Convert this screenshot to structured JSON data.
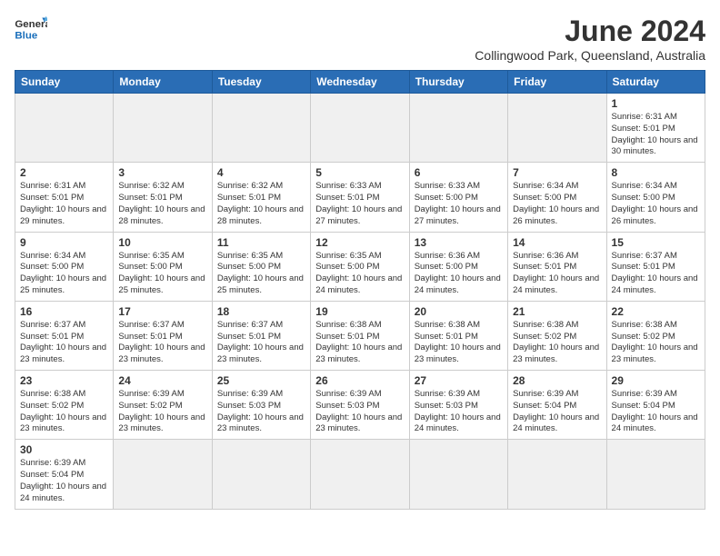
{
  "header": {
    "logo_general": "General",
    "logo_blue": "Blue",
    "title": "June 2024",
    "subtitle": "Collingwood Park, Queensland, Australia"
  },
  "days_of_week": [
    "Sunday",
    "Monday",
    "Tuesday",
    "Wednesday",
    "Thursday",
    "Friday",
    "Saturday"
  ],
  "weeks": [
    [
      {
        "day": "",
        "empty": true
      },
      {
        "day": "",
        "empty": true
      },
      {
        "day": "",
        "empty": true
      },
      {
        "day": "",
        "empty": true
      },
      {
        "day": "",
        "empty": true
      },
      {
        "day": "",
        "empty": true
      },
      {
        "day": "1",
        "sunrise": "6:31 AM",
        "sunset": "5:01 PM",
        "daylight": "10 hours and 30 minutes."
      }
    ],
    [
      {
        "day": "2",
        "sunrise": "6:31 AM",
        "sunset": "5:01 PM",
        "daylight": "10 hours and 29 minutes."
      },
      {
        "day": "3",
        "sunrise": "6:32 AM",
        "sunset": "5:01 PM",
        "daylight": "10 hours and 28 minutes."
      },
      {
        "day": "4",
        "sunrise": "6:32 AM",
        "sunset": "5:01 PM",
        "daylight": "10 hours and 28 minutes."
      },
      {
        "day": "5",
        "sunrise": "6:33 AM",
        "sunset": "5:01 PM",
        "daylight": "10 hours and 27 minutes."
      },
      {
        "day": "6",
        "sunrise": "6:33 AM",
        "sunset": "5:00 PM",
        "daylight": "10 hours and 27 minutes."
      },
      {
        "day": "7",
        "sunrise": "6:34 AM",
        "sunset": "5:00 PM",
        "daylight": "10 hours and 26 minutes."
      },
      {
        "day": "8",
        "sunrise": "6:34 AM",
        "sunset": "5:00 PM",
        "daylight": "10 hours and 26 minutes."
      }
    ],
    [
      {
        "day": "9",
        "sunrise": "6:34 AM",
        "sunset": "5:00 PM",
        "daylight": "10 hours and 25 minutes."
      },
      {
        "day": "10",
        "sunrise": "6:35 AM",
        "sunset": "5:00 PM",
        "daylight": "10 hours and 25 minutes."
      },
      {
        "day": "11",
        "sunrise": "6:35 AM",
        "sunset": "5:00 PM",
        "daylight": "10 hours and 25 minutes."
      },
      {
        "day": "12",
        "sunrise": "6:35 AM",
        "sunset": "5:00 PM",
        "daylight": "10 hours and 24 minutes."
      },
      {
        "day": "13",
        "sunrise": "6:36 AM",
        "sunset": "5:00 PM",
        "daylight": "10 hours and 24 minutes."
      },
      {
        "day": "14",
        "sunrise": "6:36 AM",
        "sunset": "5:01 PM",
        "daylight": "10 hours and 24 minutes."
      },
      {
        "day": "15",
        "sunrise": "6:37 AM",
        "sunset": "5:01 PM",
        "daylight": "10 hours and 24 minutes."
      }
    ],
    [
      {
        "day": "16",
        "sunrise": "6:37 AM",
        "sunset": "5:01 PM",
        "daylight": "10 hours and 23 minutes."
      },
      {
        "day": "17",
        "sunrise": "6:37 AM",
        "sunset": "5:01 PM",
        "daylight": "10 hours and 23 minutes."
      },
      {
        "day": "18",
        "sunrise": "6:37 AM",
        "sunset": "5:01 PM",
        "daylight": "10 hours and 23 minutes."
      },
      {
        "day": "19",
        "sunrise": "6:38 AM",
        "sunset": "5:01 PM",
        "daylight": "10 hours and 23 minutes."
      },
      {
        "day": "20",
        "sunrise": "6:38 AM",
        "sunset": "5:01 PM",
        "daylight": "10 hours and 23 minutes."
      },
      {
        "day": "21",
        "sunrise": "6:38 AM",
        "sunset": "5:02 PM",
        "daylight": "10 hours and 23 minutes."
      },
      {
        "day": "22",
        "sunrise": "6:38 AM",
        "sunset": "5:02 PM",
        "daylight": "10 hours and 23 minutes."
      }
    ],
    [
      {
        "day": "23",
        "sunrise": "6:38 AM",
        "sunset": "5:02 PM",
        "daylight": "10 hours and 23 minutes."
      },
      {
        "day": "24",
        "sunrise": "6:39 AM",
        "sunset": "5:02 PM",
        "daylight": "10 hours and 23 minutes."
      },
      {
        "day": "25",
        "sunrise": "6:39 AM",
        "sunset": "5:03 PM",
        "daylight": "10 hours and 23 minutes."
      },
      {
        "day": "26",
        "sunrise": "6:39 AM",
        "sunset": "5:03 PM",
        "daylight": "10 hours and 23 minutes."
      },
      {
        "day": "27",
        "sunrise": "6:39 AM",
        "sunset": "5:03 PM",
        "daylight": "10 hours and 24 minutes."
      },
      {
        "day": "28",
        "sunrise": "6:39 AM",
        "sunset": "5:04 PM",
        "daylight": "10 hours and 24 minutes."
      },
      {
        "day": "29",
        "sunrise": "6:39 AM",
        "sunset": "5:04 PM",
        "daylight": "10 hours and 24 minutes."
      }
    ],
    [
      {
        "day": "30",
        "sunrise": "6:39 AM",
        "sunset": "5:04 PM",
        "daylight": "10 hours and 24 minutes."
      },
      {
        "day": "",
        "empty": true
      },
      {
        "day": "",
        "empty": true
      },
      {
        "day": "",
        "empty": true
      },
      {
        "day": "",
        "empty": true
      },
      {
        "day": "",
        "empty": true
      },
      {
        "day": "",
        "empty": true
      }
    ]
  ]
}
